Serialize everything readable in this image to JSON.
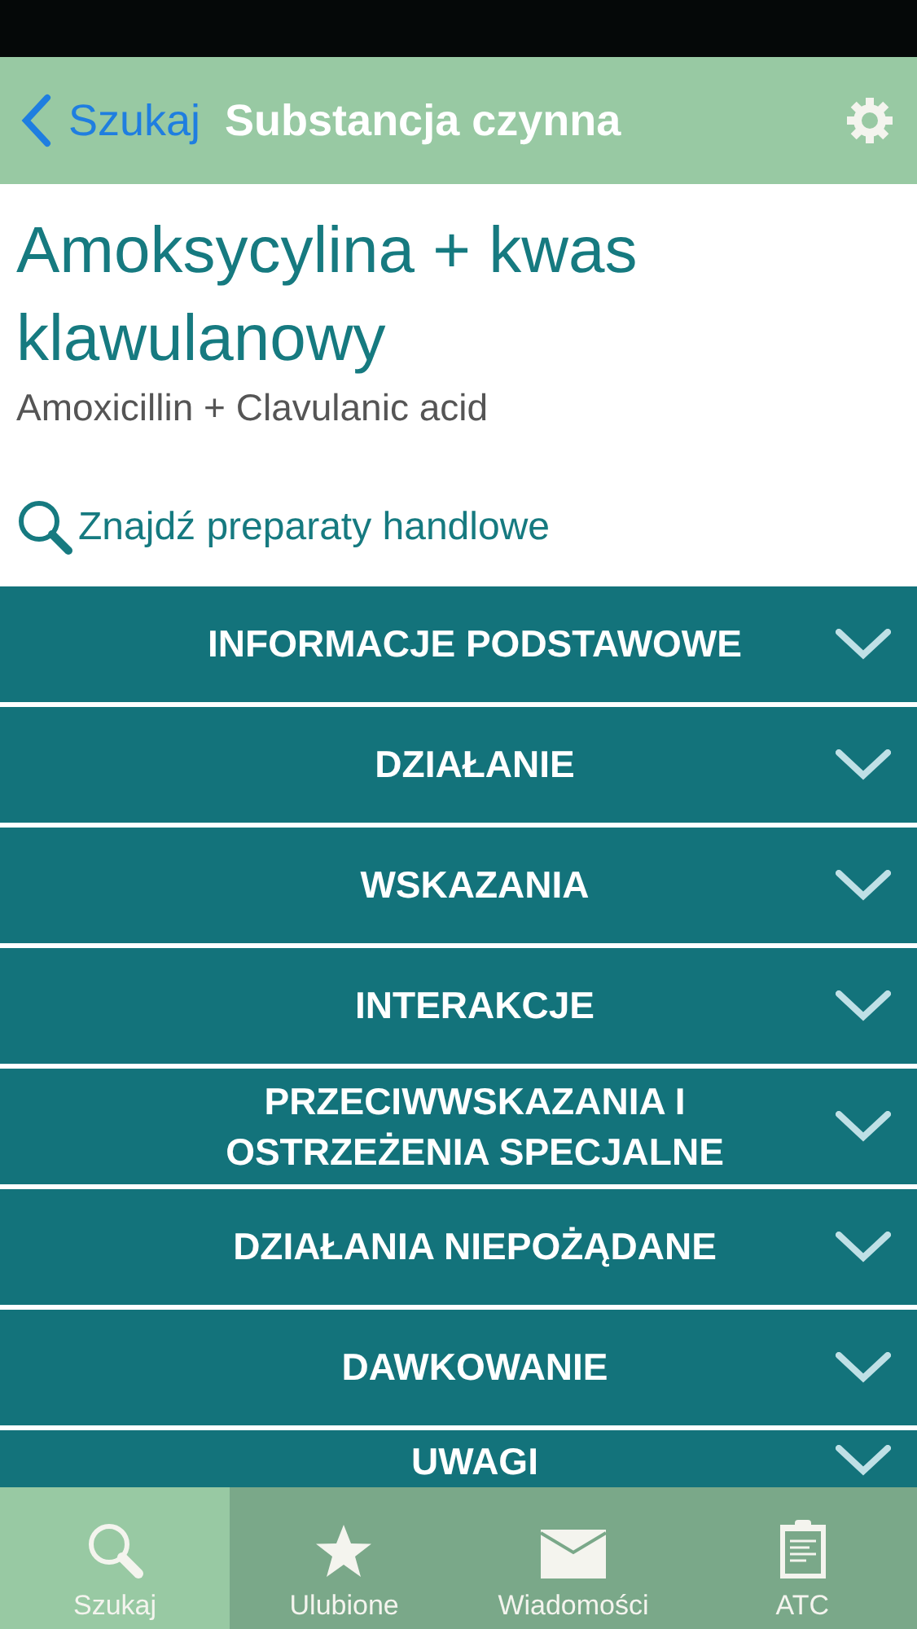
{
  "nav_bar": {
    "back_label": "Szukaj",
    "title": "Substancja czynna"
  },
  "substance": {
    "name": "Amoksycylina + kwas klawulanowy",
    "latin_name": "Amoxicillin + Clavulanic acid",
    "search_link": "Znajdź preparaty handlowe"
  },
  "sections": [
    {
      "label": "INFORMACJE PODSTAWOWE",
      "expanded": false
    },
    {
      "label": "DZIAŁANIE",
      "expanded": false
    },
    {
      "label": "WSKAZANIA",
      "expanded": false
    },
    {
      "label": "INTERAKCJE",
      "expanded": false
    },
    {
      "label": "PRZECIWWSKAZANIA I OSTRZEŻENIA SPECJALNE",
      "expanded": false
    },
    {
      "label": "DZIAŁANIA NIEPOŻĄDANE",
      "expanded": false
    },
    {
      "label": "DAWKOWANIE",
      "expanded": false
    },
    {
      "label": "UWAGI",
      "expanded": false
    }
  ],
  "tab_bar": [
    {
      "label": "Szukaj",
      "kind": "search",
      "selected": true
    },
    {
      "label": "Ulubione",
      "kind": "star",
      "selected": false
    },
    {
      "label": "Wiadomości",
      "kind": "mail",
      "selected": false
    },
    {
      "label": "ATC",
      "kind": "clipboard",
      "selected": false
    }
  ]
}
